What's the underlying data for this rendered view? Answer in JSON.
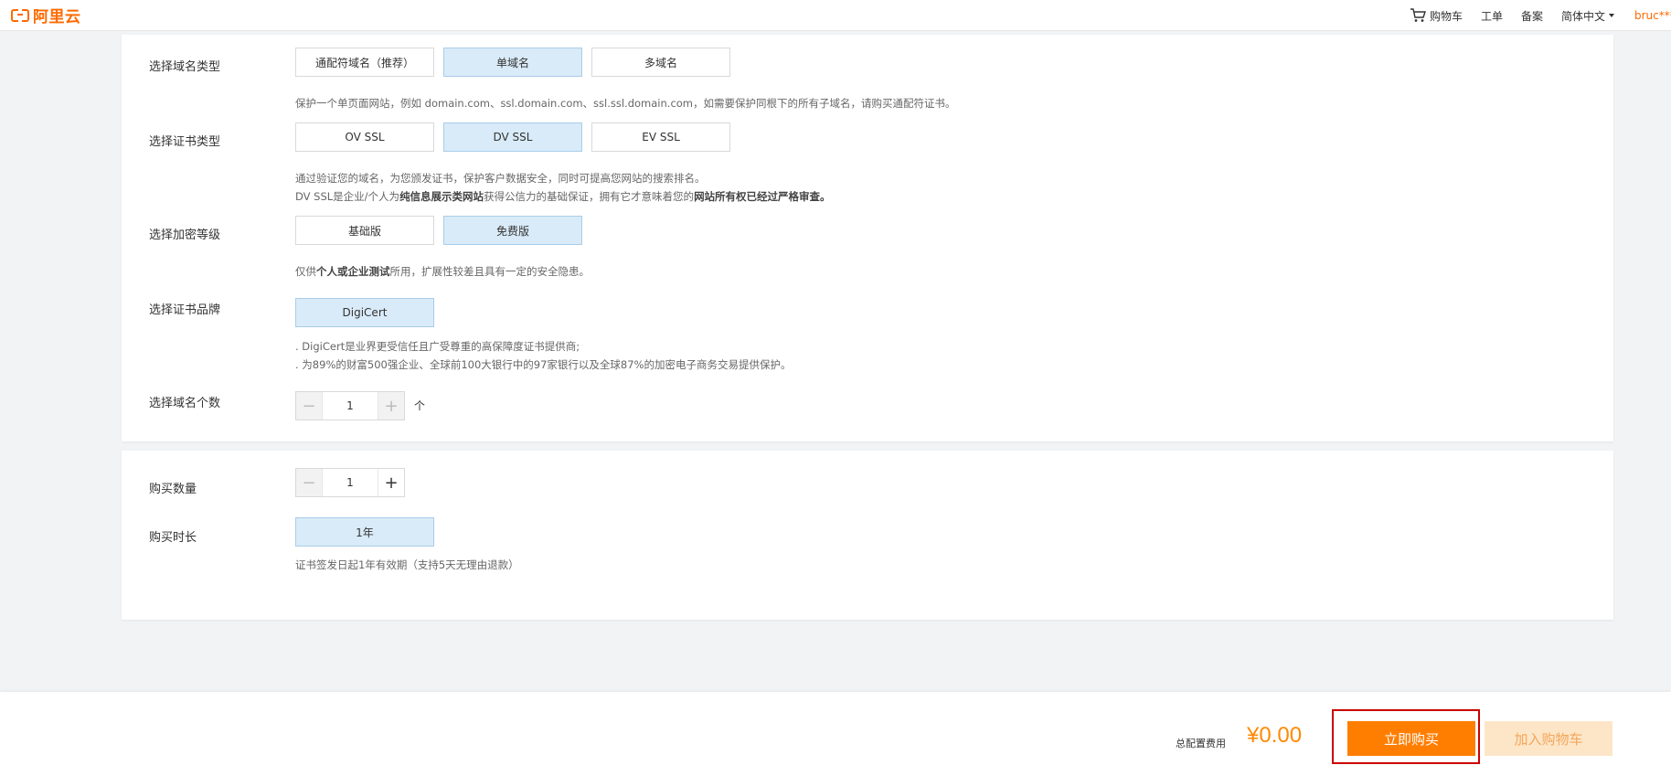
{
  "header": {
    "logo_text": "阿里云",
    "nav": {
      "cart": "购物车",
      "ticket": "工单",
      "filing": "备案",
      "language": "简体中文",
      "user": "bruc***"
    }
  },
  "config": {
    "domain_type": {
      "label": "选择域名类型",
      "options": [
        "通配符域名（推荐）",
        "单域名",
        "多域名"
      ],
      "selected": "单域名",
      "desc": "保护一个单页面网站，例如 domain.com、ssl.domain.com、ssl.ssl.domain.com，如需要保护同根下的所有子域名，请购买通配符证书。"
    },
    "cert_type": {
      "label": "选择证书类型",
      "options": [
        "OV SSL",
        "DV SSL",
        "EV SSL"
      ],
      "selected": "DV SSL",
      "desc_line1": "通过验证您的域名，为您颁发证书，保护客户数据安全，同时可提高您网站的搜索排名。",
      "desc_line2_a": "DV SSL是企业/个人为",
      "desc_line2_b": "纯信息展示类网站",
      "desc_line2_c": "获得公信力的基础保证，拥有它才意味着您的",
      "desc_line2_d": "网站所有权已经过严格审查。"
    },
    "encryption": {
      "label": "选择加密等级",
      "options": [
        "基础版",
        "免费版"
      ],
      "selected": "免费版",
      "desc_a": "仅供",
      "desc_b": "个人或企业测试",
      "desc_c": "所用，扩展性较差且具有一定的安全隐患。"
    },
    "brand": {
      "label": "选择证书品牌",
      "options": [
        "DigiCert"
      ],
      "selected": "DigiCert",
      "desc_line1": ". DigiCert是业界更受信任且广受尊重的高保障度证书提供商;",
      "desc_line2": ". 为89%的财富500强企业、全球前100大银行中的97家银行以及全球87%的加密电子商务交易提供保护。"
    },
    "domain_count": {
      "label": "选择域名个数",
      "value": "1",
      "unit": "个"
    }
  },
  "purchase": {
    "quantity": {
      "label": "购买数量",
      "value": "1"
    },
    "duration": {
      "label": "购买时长",
      "options": [
        "1年"
      ],
      "selected": "1年",
      "desc": "证书签发日起1年有效期（支持5天无理由退款）"
    }
  },
  "footer": {
    "total_label": "总配置费用",
    "total_price": "¥0.00",
    "buy_now": "立即购买",
    "add_to_cart": "加入购物车"
  },
  "colors": {
    "brand": "#ff6a00",
    "selected_bg": "#d9ebf8",
    "buy_button": "#ff7e00",
    "cart_button_bg": "#fde6c8",
    "highlight_frame": "#cc0000"
  }
}
